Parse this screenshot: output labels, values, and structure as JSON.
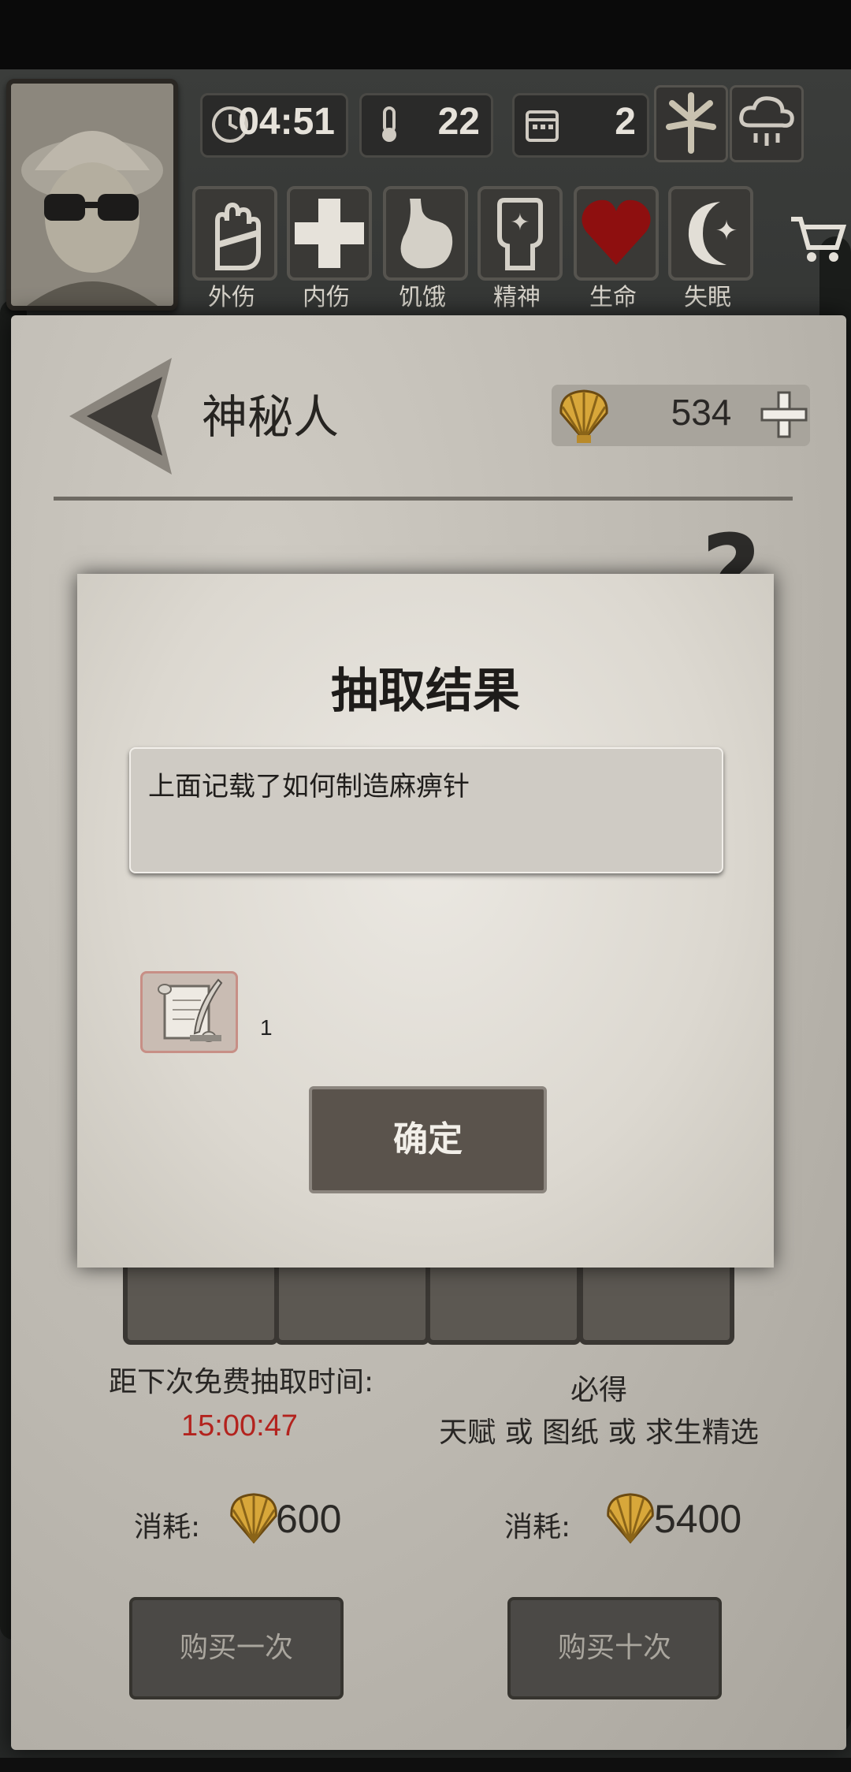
{
  "hud": {
    "time": "04:51",
    "temperature": "22",
    "day": "2",
    "stats": [
      {
        "label": "外伤",
        "icon": "hand-bandage-icon"
      },
      {
        "label": "内伤",
        "icon": "cross-icon"
      },
      {
        "label": "饥饿",
        "icon": "stomach-icon"
      },
      {
        "label": "精神",
        "icon": "mind-icon"
      },
      {
        "label": "生命",
        "icon": "heart-icon",
        "color": "#8e0f0f"
      },
      {
        "label": "失眠",
        "icon": "moon-star-icon"
      }
    ]
  },
  "header": {
    "title": "神秘人",
    "shells": "534"
  },
  "dialog": {
    "title": "抽取结果",
    "result_text": "上面记载了如何制造麻痹针",
    "item_count": "1",
    "confirm_label": "确定"
  },
  "draw": {
    "free_timer_label": "距下次免费抽取时间:",
    "free_timer_value": "15:00:47",
    "guarantee_title": "必得",
    "guarantee_desc": "天赋 或 图纸 或 求生精选",
    "cost_label": "消耗:",
    "cost_single": "600",
    "cost_ten": "5400",
    "buy_once": "购买一次",
    "buy_ten": "购买十次"
  },
  "colors": {
    "timer_red": "#b3231e",
    "paper": "#bfbcb5"
  }
}
